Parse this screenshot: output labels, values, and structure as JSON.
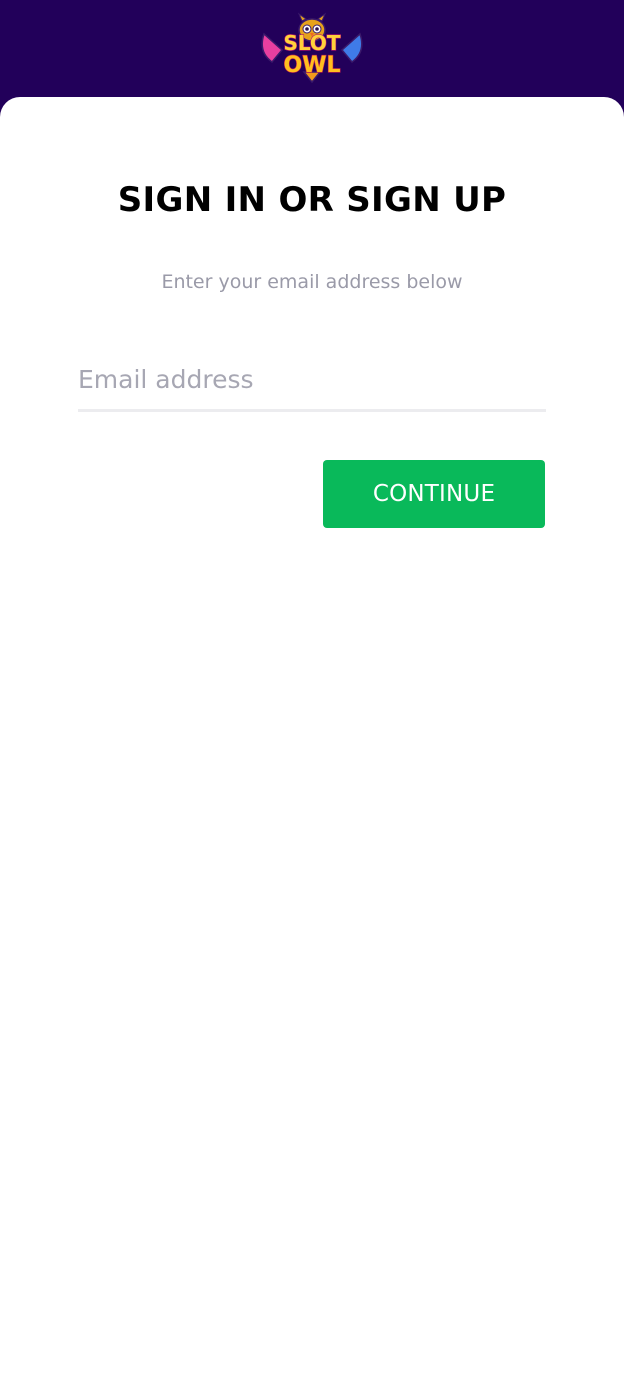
{
  "header": {
    "logo_top": "SLOT",
    "logo_bottom": "OWL",
    "background_color": "#22005a"
  },
  "form": {
    "title": "SIGN IN OR SIGN UP",
    "subtitle": "Enter your email address below",
    "email_placeholder": "Email address",
    "email_value": "",
    "continue_label": "CONTINUE",
    "button_color": "#09b95a"
  }
}
